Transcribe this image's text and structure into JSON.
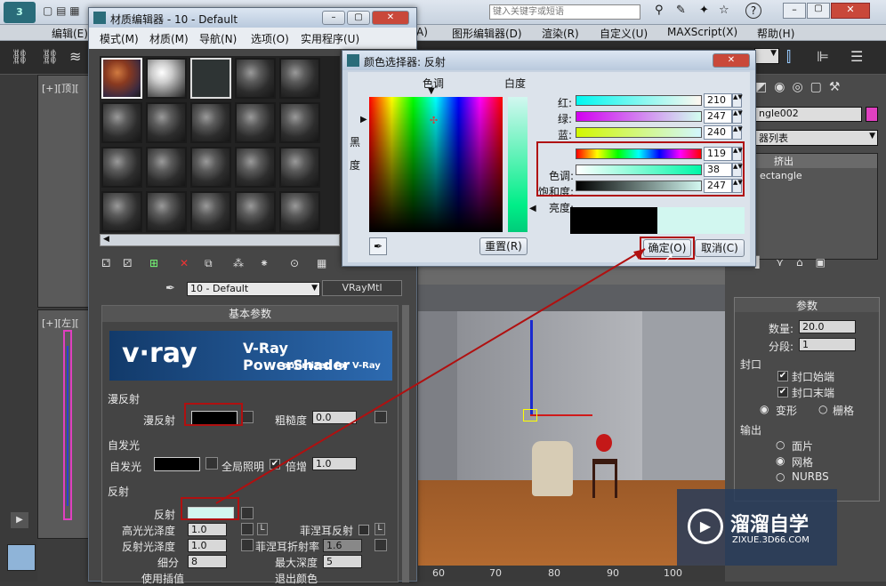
{
  "app": {
    "search_placeholder": "键入关键字或短语",
    "menu": [
      "编辑(E)",
      "图形编辑器(D)",
      "渲染(R)",
      "自定义(U)",
      "MAXScript(X)",
      "帮助(H)"
    ],
    "menu_partial": "A)"
  },
  "viewports": {
    "top_label": "[+][顶][",
    "left_label": "[+][左][",
    "ruler": [
      "60",
      "70",
      "80",
      "90",
      "100"
    ]
  },
  "command_panel": {
    "object_name": "ngle002",
    "modifier_list_label": "器列表",
    "stack_items": [
      "挤出",
      "ectangle"
    ],
    "params_title": "参数",
    "amount_label": "数量:",
    "amount_value": "20.0",
    "segments_label": "分段:",
    "segments_value": "1",
    "capping_title": "封口",
    "cap_start": "封口始端",
    "cap_end": "封口末端",
    "morph": "变形",
    "grid": "栅格",
    "output_title": "输出",
    "output_options": [
      "面片",
      "网格",
      "NURBS"
    ]
  },
  "material_editor": {
    "title": "材质编辑器 - 10 - Default",
    "menu": [
      "模式(M)",
      "材质(M)",
      "导航(N)",
      "选项(O)",
      "实用程序(U)"
    ],
    "material_name": "10 - Default",
    "material_type": "VRayMtl",
    "rollout_title": "基本参数",
    "vray_logo": "v·ray",
    "vray_title": "V-Ray PowerShader",
    "vray_subtitle": "optimized for V-Ray",
    "diffuse_group": "漫反射",
    "diffuse_label": "漫反射",
    "roughness_label": "粗糙度",
    "roughness_value": "0.0",
    "self_illum_group": "自发光",
    "self_illum_label": "自发光",
    "gi_label": "全局照明",
    "multiplier_label": "倍增",
    "multiplier_value": "1.0",
    "reflect_group": "反射",
    "reflect_label": "反射",
    "hilight_gloss_label": "高光光泽度",
    "hilight_gloss_value": "1.0",
    "fresnel_label": "菲涅耳反射",
    "refl_gloss_label": "反射光泽度",
    "refl_gloss_value": "1.0",
    "fresnel_ior_label": "菲涅耳折射率",
    "fresnel_ior_value": "1.6",
    "subdivs_label": "细分",
    "subdivs_value": "8",
    "max_depth_label": "最大深度",
    "max_depth_value": "5",
    "use_interp_label": "使用插值",
    "exit_color_label": "退出颜色",
    "L": "L"
  },
  "color_picker": {
    "title": "颜色选择器: 反射",
    "hue_header": "色调",
    "whiteness_header": "白度",
    "blackness_label_1": "黑",
    "blackness_label_2": "度",
    "red_label": "红:",
    "red_value": "210",
    "green_label": "绿:",
    "green_value": "247",
    "blue_label": "蓝:",
    "blue_value": "240",
    "hue_label": "色调:",
    "hue_value": "119",
    "sat_label": "饱和度:",
    "sat_value": "38",
    "val_label": "亮度:",
    "val_value": "247",
    "reset_label": "重置(R)",
    "ok_label": "确定(O)",
    "cancel_label": "取消(C)",
    "new_color": "#d2f7f0",
    "old_color": "#000000"
  },
  "watermark": {
    "brand": "溜溜自学",
    "url": "ZIXUE.3D66.COM"
  },
  "colors": {
    "highlight_red": "#b01010",
    "reflect_swatch": "#d2f7f0",
    "magenta_swatch": "#e040c0"
  }
}
